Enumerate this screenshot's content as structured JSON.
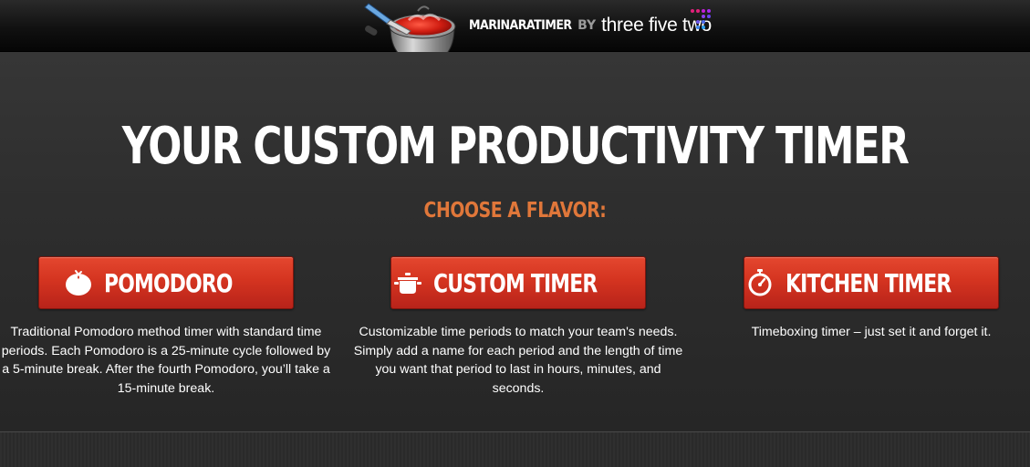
{
  "header": {
    "brand_name": "MARINARATIMER",
    "brand_by": "BY",
    "brand_company": "three five two",
    "logo_icon": "pot-of-sauce-icon",
    "company_icon": "dot-grid-icon"
  },
  "hero": {
    "headline": "YOUR CUSTOM PRODUCTIVITY TIMER",
    "subhead": "CHOOSE A FLAVOR:"
  },
  "options": [
    {
      "label": "POMODORO",
      "icon": "tomato-icon",
      "description": "Traditional Pomodoro method timer with standard time periods. Each Pomodoro is a 25-minute cycle followed by a 5-minute break. After the fourth Pomodoro, you’ll take a 15-minute break."
    },
    {
      "label": "CUSTOM TIMER",
      "icon": "cooking-pot-icon",
      "description": "Customizable time periods to match your team's needs. Simply add a name for each period and the length of time you want that period to last in hours, minutes, and seconds."
    },
    {
      "label": "KITCHEN TIMER",
      "icon": "stopwatch-icon",
      "description": "Timeboxing timer – just set it and forget it."
    }
  ],
  "colors": {
    "accent_orange": "#e0773a",
    "button_red": "#d43420",
    "background": "#2b2b2b"
  }
}
